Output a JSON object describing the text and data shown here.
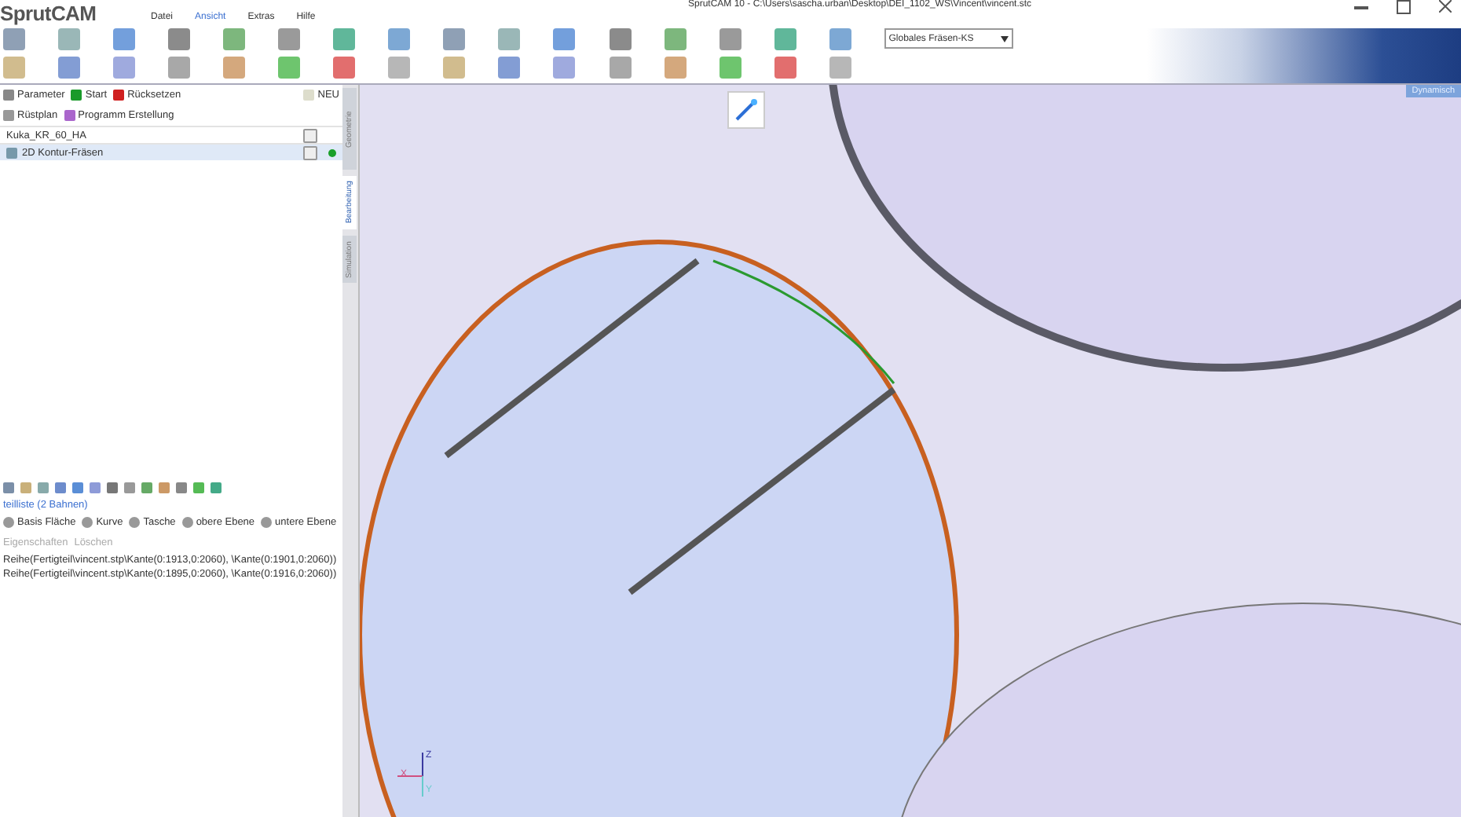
{
  "window": {
    "title": "SprutCAM 10 - C:\\Users\\sascha.urban\\Desktop\\DEI_1102_WS\\Vincent\\vincent.stc",
    "logo": "SprutCAM"
  },
  "menu": [
    {
      "label": "Datei",
      "selected": false
    },
    {
      "label": "Ansicht",
      "selected": true
    },
    {
      "label": "Extras",
      "selected": false
    },
    {
      "label": "Hilfe",
      "selected": false
    }
  ],
  "toolbar": {
    "coordinate_system": "Globales Fräsen-KS"
  },
  "operations": {
    "actions": [
      {
        "label": "Parameter",
        "kind": "params"
      },
      {
        "label": "Start",
        "kind": "start"
      },
      {
        "label": "Rücksetzen",
        "kind": "reset"
      }
    ],
    "new_label": "NEU",
    "links": [
      {
        "label": "Rüstplan",
        "kind": "setup"
      },
      {
        "label": "Programm Erstellung",
        "kind": "program"
      }
    ],
    "items": [
      {
        "label": "Kuka_KR_60_HA",
        "selected": false,
        "done": false,
        "kind": "machine"
      },
      {
        "label": "2D Kontur-Fräsen",
        "selected": true,
        "done": true,
        "kind": "operation"
      }
    ]
  },
  "side_tabs": [
    {
      "label": "Geometrie",
      "selected": false
    },
    {
      "label": "Bearbeitung",
      "selected": true
    },
    {
      "label": "Simulation",
      "selected": false
    }
  ],
  "job": {
    "title": "teilliste (2 Bahnen)",
    "types": [
      {
        "label": "Basis Fläche"
      },
      {
        "label": "Kurve"
      },
      {
        "label": "Tasche"
      },
      {
        "label": "obere Ebene"
      },
      {
        "label": "untere Ebene"
      }
    ],
    "actions": [
      {
        "label": "Eigenschaften",
        "disabled": true
      },
      {
        "label": "Löschen",
        "disabled": true
      }
    ],
    "paths": [
      "Reihe(Fertigteil\\vincent.stp\\Kante(0:1913,0:2060), \\Kante(0:1901,0:2060))",
      "Reihe(Fertigteil\\vincent.stp\\Kante(0:1895,0:2060), \\Kante(0:1916,0:2060))"
    ]
  },
  "viewport": {
    "view_mode": "Dynamisch",
    "axes": [
      "Z",
      "X",
      "Y"
    ]
  }
}
